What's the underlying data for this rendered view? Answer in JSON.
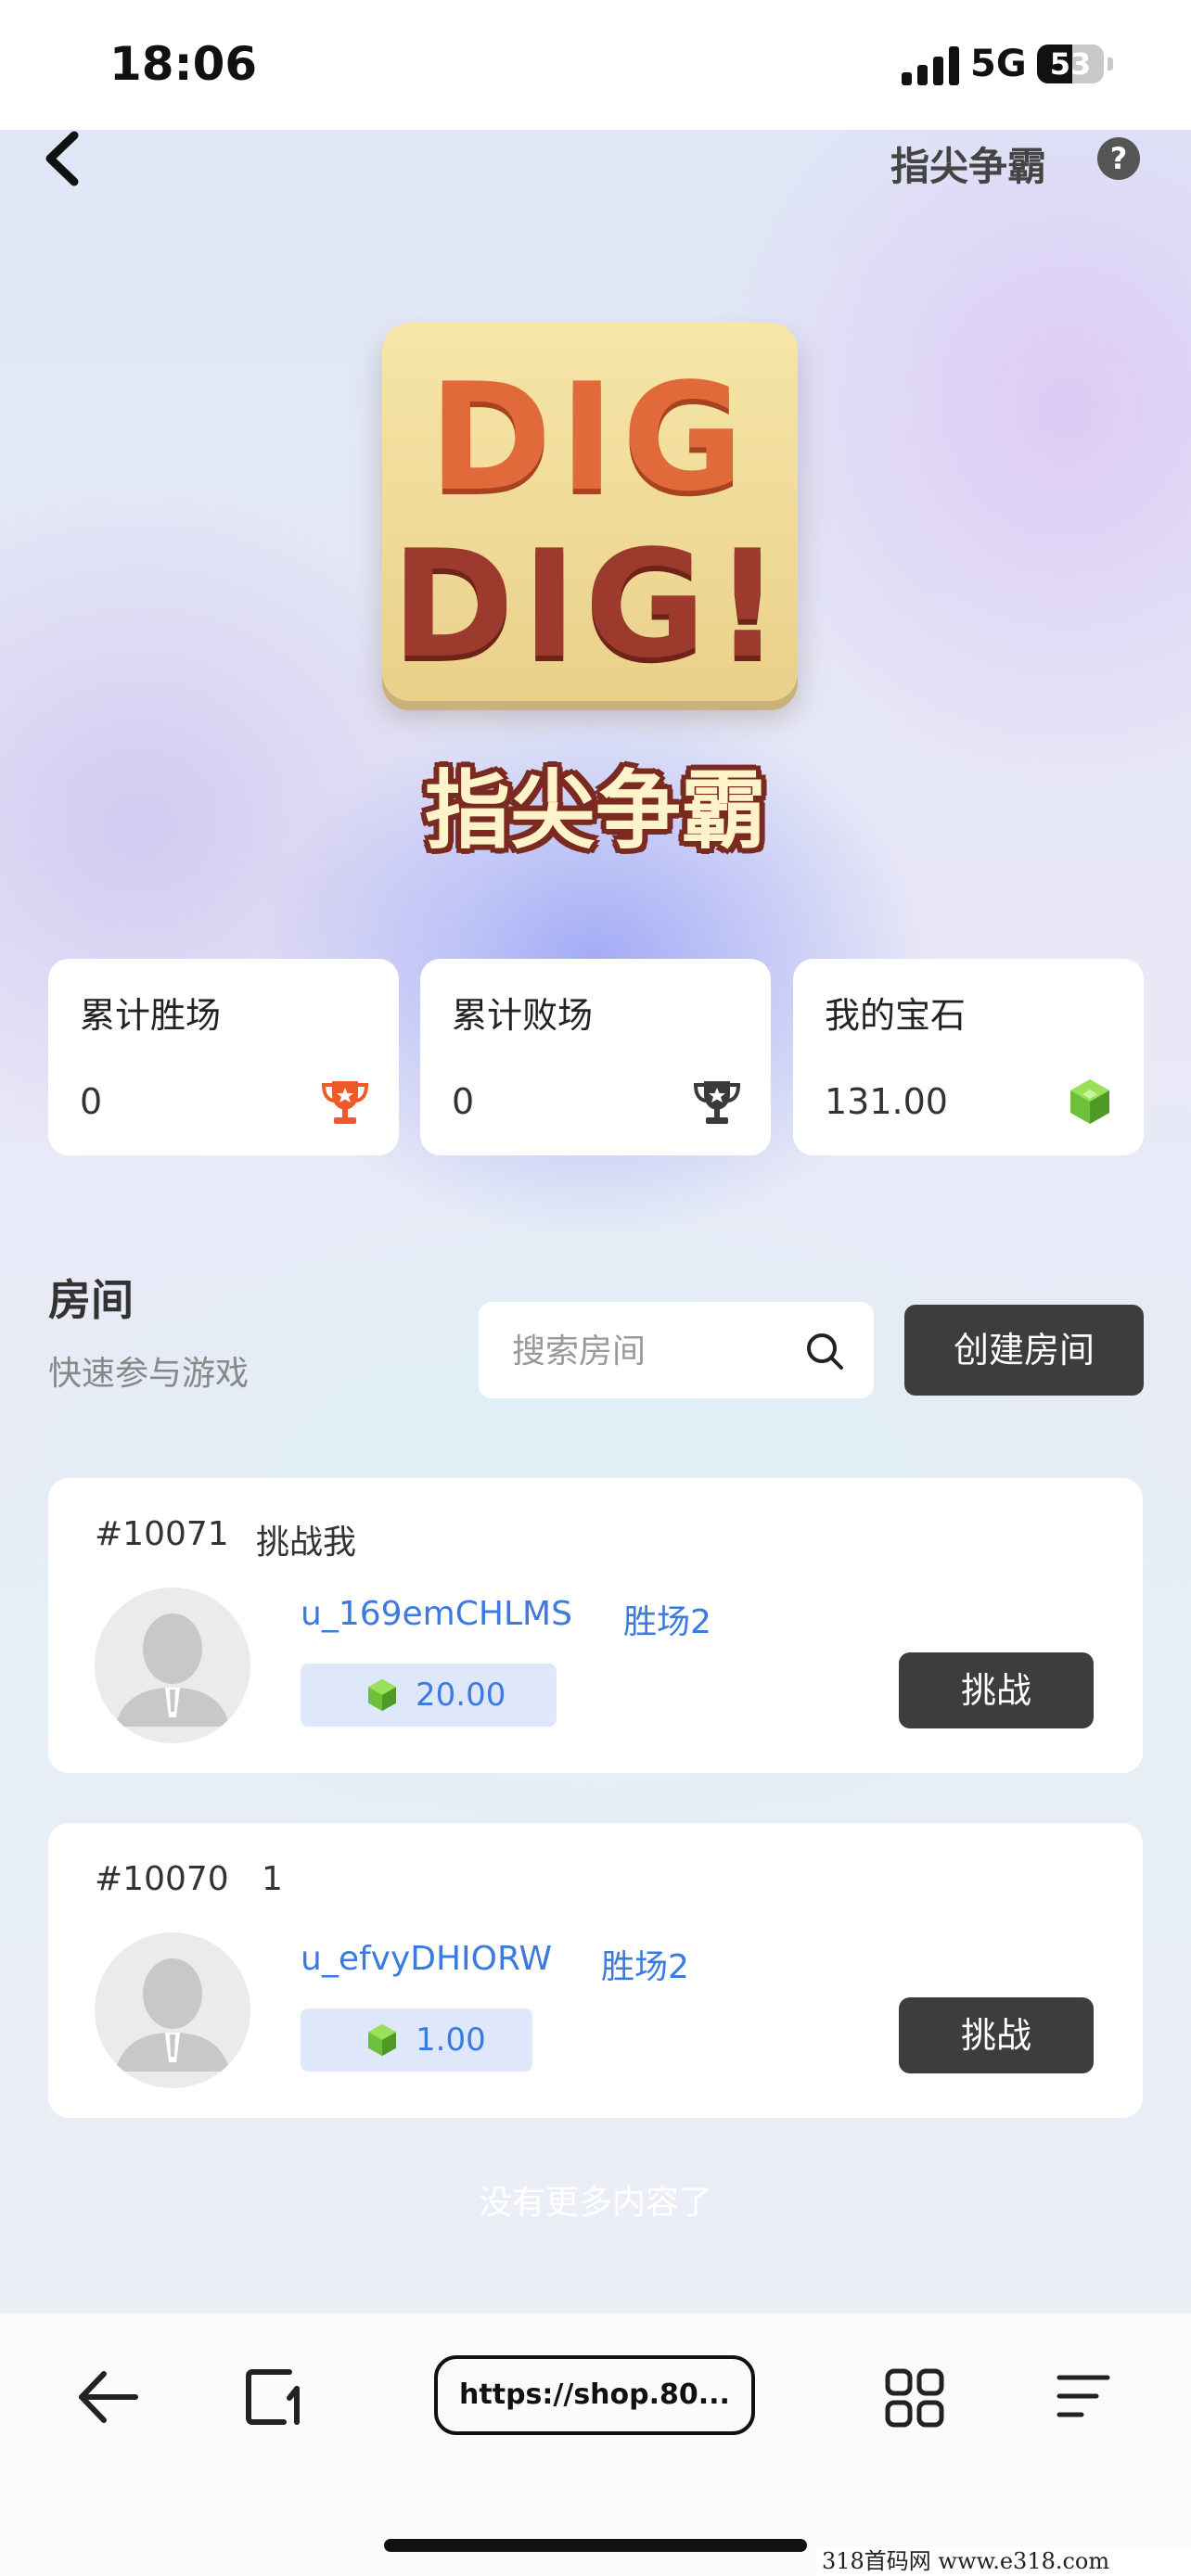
{
  "status_bar": {
    "time": "18:06",
    "network": "5G",
    "battery": "53",
    "battery_level": 0.53
  },
  "header": {
    "title": "指尖争霸",
    "help_icon": "?"
  },
  "logo": {
    "line1": "DIG",
    "line2": "DIG!",
    "game_title": "指尖争霸"
  },
  "stats": [
    {
      "label": "累计胜场",
      "value": "0",
      "icon": "trophy-icon",
      "color": "#f05a2a"
    },
    {
      "label": "累计败场",
      "value": "0",
      "icon": "trophy-icon",
      "color": "#3a3a3a"
    },
    {
      "label": "我的宝石",
      "value": "131.00",
      "icon": "gem-icon",
      "color": "#6cc03a"
    }
  ],
  "rooms_section": {
    "title": "房间",
    "subtitle": "快速参与游戏",
    "search_placeholder": "搜索房间",
    "create_button": "创建房间"
  },
  "rooms": [
    {
      "id": "#10071",
      "name": "挑战我",
      "username": "u_169emCHLMS",
      "wins": "胜场2",
      "gems": "20.00",
      "action": "挑战"
    },
    {
      "id": "#10070",
      "name": "1",
      "username": "u_efvyDHIORW",
      "wins": "胜场2",
      "gems": "1.00",
      "action": "挑战"
    }
  ],
  "footer_text": "没有更多内容了",
  "browser": {
    "url": "https://shop.80..."
  },
  "watermark": "318首码网 www.e318.com",
  "colors": {
    "accent_blue": "#3b7ae0",
    "button_dark": "#3d3d3d"
  }
}
